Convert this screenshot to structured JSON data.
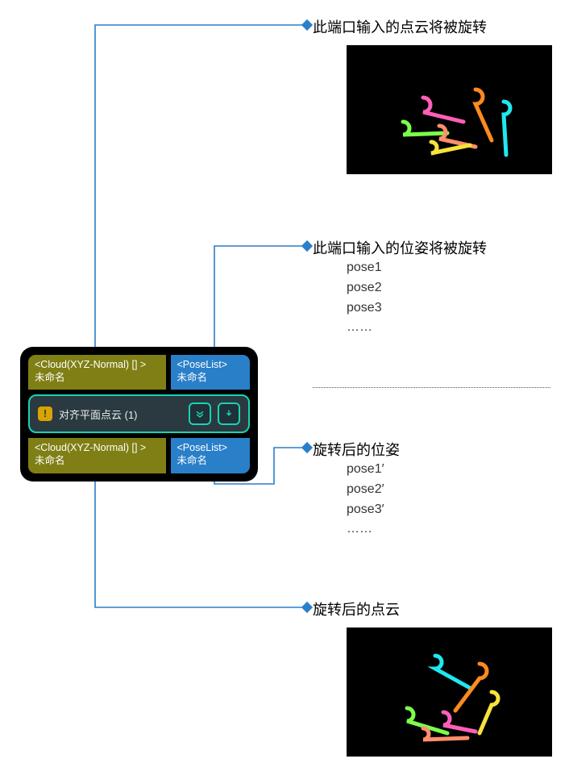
{
  "node": {
    "inputs": {
      "cloud": {
        "type": "<Cloud(XYZ-Normal) [] >",
        "name": "未命名"
      },
      "pose": {
        "type": "<PoseList>",
        "name": "未命名"
      }
    },
    "outputs": {
      "cloud": {
        "type": "<Cloud(XYZ-Normal) [] >",
        "name": "未命名"
      },
      "pose": {
        "type": "<PoseList>",
        "name": "未命名"
      }
    },
    "title": "对齐平面点云 (1)",
    "warn_glyph": "!"
  },
  "annotations": {
    "in_cloud": {
      "heading": "此端口输入的点云将被旋转"
    },
    "in_pose": {
      "heading": "此端口输入的位姿将被旋转",
      "lines": [
        "pose1",
        "pose2",
        "pose3",
        "……"
      ]
    },
    "out_pose": {
      "heading": "旋转后的位姿",
      "lines": [
        "pose1′",
        "pose2′",
        "pose3′",
        "……"
      ]
    },
    "out_cloud": {
      "heading": "旋转后的点云"
    }
  },
  "colors": {
    "connector": "#2a7fc9",
    "olive": "#7f7f15",
    "blue": "#2a7fc9",
    "teal": "#17d3b4"
  }
}
